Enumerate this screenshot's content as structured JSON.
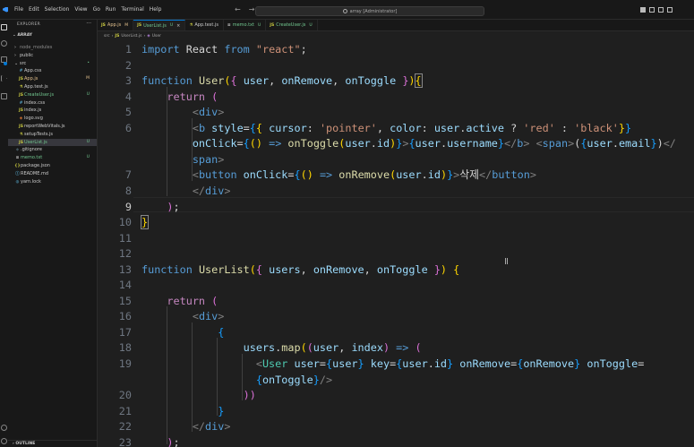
{
  "titlebar": {
    "menu": [
      "File",
      "Edit",
      "Selection",
      "View",
      "Go",
      "Run",
      "Terminal",
      "Help"
    ],
    "search_text": "array [Administrator]"
  },
  "explorer": {
    "title": "EXPLORER",
    "root": "ARRAY",
    "outline": "OUTLINE",
    "items": [
      {
        "label": "node_modules",
        "kind": "folder",
        "depth": 1,
        "color": "#8b8b8b"
      },
      {
        "label": "public",
        "kind": "folder",
        "depth": 1,
        "color": "#cccccc"
      },
      {
        "label": "src",
        "kind": "folder-open",
        "depth": 1,
        "color": "#cccccc",
        "status": "•",
        "status_color": "#73c991"
      },
      {
        "label": "App.css",
        "kind": "file",
        "icon": "#",
        "icon_color": "#519aba",
        "depth": 2,
        "color": "#cccccc"
      },
      {
        "label": "App.js",
        "kind": "file",
        "icon": "JS",
        "icon_color": "#cbcb41",
        "depth": 2,
        "color": "#e2c08d",
        "status": "M",
        "status_color": "#e2c08d"
      },
      {
        "label": "App.test.js",
        "kind": "file",
        "icon": "⚗",
        "icon_color": "#cbcb41",
        "depth": 2,
        "color": "#cccccc"
      },
      {
        "label": "CreateUser.js",
        "kind": "file",
        "icon": "JS",
        "icon_color": "#cbcb41",
        "depth": 2,
        "color": "#73c991",
        "status": "U",
        "status_color": "#73c991"
      },
      {
        "label": "index.css",
        "kind": "file",
        "icon": "#",
        "icon_color": "#519aba",
        "depth": 2,
        "color": "#cccccc"
      },
      {
        "label": "index.js",
        "kind": "file",
        "icon": "JS",
        "icon_color": "#cbcb41",
        "depth": 2,
        "color": "#cccccc"
      },
      {
        "label": "logo.svg",
        "kind": "file",
        "icon": "◈",
        "icon_color": "#e37933",
        "depth": 2,
        "color": "#cccccc"
      },
      {
        "label": "reportWebVitals.js",
        "kind": "file",
        "icon": "JS",
        "icon_color": "#cbcb41",
        "depth": 2,
        "color": "#cccccc"
      },
      {
        "label": "setupTests.js",
        "kind": "file",
        "icon": "⚗",
        "icon_color": "#cbcb41",
        "depth": 2,
        "color": "#cccccc"
      },
      {
        "label": "UserList.js",
        "kind": "file",
        "icon": "JS",
        "icon_color": "#cbcb41",
        "depth": 2,
        "color": "#73c991",
        "status": "U",
        "status_color": "#73c991",
        "selected": true
      },
      {
        "label": ".gitignore",
        "kind": "file",
        "icon": "◆",
        "icon_color": "#41535b",
        "depth": 1,
        "color": "#cccccc"
      },
      {
        "label": "memo.txt",
        "kind": "file",
        "icon": "≡",
        "icon_color": "#cccccc",
        "depth": 1,
        "color": "#73c991",
        "status": "U",
        "status_color": "#73c991"
      },
      {
        "label": "package.json",
        "kind": "file",
        "icon": "{}",
        "icon_color": "#cbcb41",
        "depth": 1,
        "color": "#cccccc"
      },
      {
        "label": "README.md",
        "kind": "file",
        "icon": "ⓘ",
        "icon_color": "#519aba",
        "depth": 1,
        "color": "#cccccc"
      },
      {
        "label": "yarn.lock",
        "kind": "file",
        "icon": "◍",
        "icon_color": "#519aba",
        "depth": 1,
        "color": "#cccccc"
      }
    ]
  },
  "tabs": [
    {
      "label": "App.js",
      "icon": "JS",
      "icon_color": "#cbcb41",
      "status": "M",
      "label_color": "#e2c08d",
      "active": false
    },
    {
      "label": "UserList.js",
      "icon": "JS",
      "icon_color": "#cbcb41",
      "status": "U",
      "label_color": "#73c991",
      "active": true
    },
    {
      "label": "App.test.js",
      "icon": "⚗",
      "icon_color": "#cbcb41",
      "status": "",
      "label_color": "#cccccc",
      "active": false
    },
    {
      "label": "memo.txt",
      "icon": "≡",
      "icon_color": "#cccccc",
      "status": "U",
      "label_color": "#73c991",
      "active": false
    },
    {
      "label": "CreateUser.js",
      "icon": "JS",
      "icon_color": "#cbcb41",
      "status": "U",
      "label_color": "#73c991",
      "active": false
    }
  ],
  "breadcrumb": [
    "src",
    "UserList.js",
    "User"
  ],
  "editor": {
    "active_line": "9",
    "lines": [
      {
        "num": "1",
        "tokens": [
          [
            "kw",
            "import"
          ],
          [
            "tx",
            " React "
          ],
          [
            "kw",
            "from"
          ],
          [
            "tx",
            " "
          ],
          [
            "str",
            "\"react\""
          ],
          [
            "tx",
            ";"
          ]
        ]
      },
      {
        "num": "2",
        "tokens": []
      },
      {
        "num": "3",
        "tokens": [
          [
            "kw",
            "function"
          ],
          [
            "tx",
            " "
          ],
          [
            "fn",
            "User"
          ],
          [
            "b1",
            "("
          ],
          [
            "b2",
            "{"
          ],
          [
            "tx",
            " "
          ],
          [
            "vr",
            "user"
          ],
          [
            "tx",
            ", "
          ],
          [
            "vr",
            "onRemove"
          ],
          [
            "tx",
            ", "
          ],
          [
            "vr",
            "onToggle"
          ],
          [
            "tx",
            " "
          ],
          [
            "b2",
            "}"
          ],
          [
            "b1",
            ")"
          ],
          [
            "b1",
            "{"
          ]
        ]
      },
      {
        "num": "4",
        "tokens": [
          [
            "tx",
            "    "
          ],
          [
            "ctl",
            "return"
          ],
          [
            "tx",
            " "
          ],
          [
            "b2",
            "("
          ]
        ]
      },
      {
        "num": "5",
        "tokens": [
          [
            "tx",
            "        "
          ],
          [
            "gy",
            "<"
          ],
          [
            "tg",
            "div"
          ],
          [
            "gy",
            ">"
          ]
        ]
      },
      {
        "num": "6",
        "tokens": [
          [
            "tx",
            "        "
          ],
          [
            "gy",
            "<"
          ],
          [
            "tg",
            "b"
          ],
          [
            "tx",
            " "
          ],
          [
            "vr",
            "style"
          ],
          [
            "tx",
            "="
          ],
          [
            "b3",
            "{"
          ],
          [
            "b1",
            "{"
          ],
          [
            "tx",
            " "
          ],
          [
            "vr",
            "cursor"
          ],
          [
            "tx",
            ": "
          ],
          [
            "str",
            "'pointer'"
          ],
          [
            "tx",
            ", "
          ],
          [
            "vr",
            "color"
          ],
          [
            "tx",
            ": "
          ],
          [
            "vr",
            "user"
          ],
          [
            "tx",
            "."
          ],
          [
            "vr",
            "active"
          ],
          [
            "tx",
            " ? "
          ],
          [
            "str",
            "'red'"
          ],
          [
            "tx",
            " : "
          ],
          [
            "str",
            "'black'"
          ],
          [
            "b1",
            "}"
          ],
          [
            "b3",
            "}"
          ]
        ]
      },
      {
        "num": "",
        "tokens": [
          [
            "tx",
            "        "
          ],
          [
            "vr",
            "onClick"
          ],
          [
            "tx",
            "="
          ],
          [
            "b3",
            "{"
          ],
          [
            "b1",
            "("
          ],
          [
            "b1",
            ")"
          ],
          [
            "tx",
            " "
          ],
          [
            "kw",
            "=>"
          ],
          [
            "tx",
            " "
          ],
          [
            "fn",
            "onToggle"
          ],
          [
            "b1",
            "("
          ],
          [
            "vr",
            "user"
          ],
          [
            "tx",
            "."
          ],
          [
            "vr",
            "id"
          ],
          [
            "b1",
            ")"
          ],
          [
            "b3",
            "}"
          ],
          [
            "gy",
            ">"
          ],
          [
            "b3",
            "{"
          ],
          [
            "vr",
            "user"
          ],
          [
            "tx",
            "."
          ],
          [
            "vr",
            "username"
          ],
          [
            "b3",
            "}"
          ],
          [
            "gy",
            "</"
          ],
          [
            "tg",
            "b"
          ],
          [
            "gy",
            ">"
          ],
          [
            "tx",
            " "
          ],
          [
            "gy",
            "<"
          ],
          [
            "tg",
            "span"
          ],
          [
            "gy",
            ">"
          ],
          [
            "tx",
            "("
          ],
          [
            "b3",
            "{"
          ],
          [
            "vr",
            "user"
          ],
          [
            "tx",
            "."
          ],
          [
            "vr",
            "email"
          ],
          [
            "b3",
            "}"
          ],
          [
            "tx",
            ")"
          ],
          [
            "gy",
            "</"
          ]
        ]
      },
      {
        "num": "",
        "tokens": [
          [
            "tx",
            "        "
          ],
          [
            "tg",
            "span"
          ],
          [
            "gy",
            ">"
          ]
        ]
      },
      {
        "num": "7",
        "tokens": [
          [
            "tx",
            "        "
          ],
          [
            "gy",
            "<"
          ],
          [
            "tg",
            "button"
          ],
          [
            "tx",
            " "
          ],
          [
            "vr",
            "onClick"
          ],
          [
            "tx",
            "="
          ],
          [
            "b3",
            "{"
          ],
          [
            "b1",
            "("
          ],
          [
            "b1",
            ")"
          ],
          [
            "tx",
            " "
          ],
          [
            "kw",
            "=>"
          ],
          [
            "tx",
            " "
          ],
          [
            "fn",
            "onRemove"
          ],
          [
            "b1",
            "("
          ],
          [
            "vr",
            "user"
          ],
          [
            "tx",
            "."
          ],
          [
            "vr",
            "id"
          ],
          [
            "b1",
            ")"
          ],
          [
            "b3",
            "}"
          ],
          [
            "gy",
            ">"
          ],
          [
            "tx",
            "삭제"
          ],
          [
            "gy",
            "</"
          ],
          [
            "tg",
            "button"
          ],
          [
            "gy",
            ">"
          ]
        ]
      },
      {
        "num": "8",
        "tokens": [
          [
            "tx",
            "        "
          ],
          [
            "gy",
            "</"
          ],
          [
            "tg",
            "div"
          ],
          [
            "gy",
            ">"
          ]
        ]
      },
      {
        "num": "9",
        "tokens": [
          [
            "tx",
            "    "
          ],
          [
            "b2",
            ")"
          ],
          [
            "tx",
            ";"
          ]
        ]
      },
      {
        "num": "10",
        "tokens": [
          [
            "b1",
            "}"
          ]
        ]
      },
      {
        "num": "11",
        "tokens": []
      },
      {
        "num": "12",
        "tokens": []
      },
      {
        "num": "13",
        "tokens": [
          [
            "kw",
            "function"
          ],
          [
            "tx",
            " "
          ],
          [
            "fn",
            "UserList"
          ],
          [
            "b1",
            "("
          ],
          [
            "b2",
            "{"
          ],
          [
            "tx",
            " "
          ],
          [
            "vr",
            "users"
          ],
          [
            "tx",
            ", "
          ],
          [
            "vr",
            "onRemove"
          ],
          [
            "tx",
            ", "
          ],
          [
            "vr",
            "onToggle"
          ],
          [
            "tx",
            " "
          ],
          [
            "b2",
            "}"
          ],
          [
            "b1",
            ")"
          ],
          [
            "tx",
            " "
          ],
          [
            "b1",
            "{"
          ]
        ]
      },
      {
        "num": "14",
        "tokens": []
      },
      {
        "num": "15",
        "tokens": [
          [
            "tx",
            "    "
          ],
          [
            "ctl",
            "return"
          ],
          [
            "tx",
            " "
          ],
          [
            "b2",
            "("
          ]
        ]
      },
      {
        "num": "16",
        "tokens": [
          [
            "tx",
            "        "
          ],
          [
            "gy",
            "<"
          ],
          [
            "tg",
            "div"
          ],
          [
            "gy",
            ">"
          ]
        ]
      },
      {
        "num": "17",
        "tokens": [
          [
            "tx",
            "            "
          ],
          [
            "b3",
            "{"
          ]
        ]
      },
      {
        "num": "18",
        "tokens": [
          [
            "tx",
            "                "
          ],
          [
            "vr",
            "users"
          ],
          [
            "tx",
            "."
          ],
          [
            "fn",
            "map"
          ],
          [
            "b1",
            "("
          ],
          [
            "b2",
            "("
          ],
          [
            "vr",
            "user"
          ],
          [
            "tx",
            ", "
          ],
          [
            "vr",
            "index"
          ],
          [
            "b2",
            ")"
          ],
          [
            "tx",
            " "
          ],
          [
            "kw",
            "=>"
          ],
          [
            "tx",
            " "
          ],
          [
            "b2",
            "("
          ]
        ]
      },
      {
        "num": "19",
        "tokens": [
          [
            "tx",
            "                  "
          ],
          [
            "gy",
            "<"
          ],
          [
            "cm",
            "User"
          ],
          [
            "tx",
            " "
          ],
          [
            "vr",
            "user"
          ],
          [
            "tx",
            "="
          ],
          [
            "b3",
            "{"
          ],
          [
            "vr",
            "user"
          ],
          [
            "b3",
            "}"
          ],
          [
            "tx",
            " "
          ],
          [
            "vr",
            "key"
          ],
          [
            "tx",
            "="
          ],
          [
            "b3",
            "{"
          ],
          [
            "vr",
            "user"
          ],
          [
            "tx",
            "."
          ],
          [
            "vr",
            "id"
          ],
          [
            "b3",
            "}"
          ],
          [
            "tx",
            " "
          ],
          [
            "vr",
            "onRemove"
          ],
          [
            "tx",
            "="
          ],
          [
            "b3",
            "{"
          ],
          [
            "vr",
            "onRemove"
          ],
          [
            "b3",
            "}"
          ],
          [
            "tx",
            " "
          ],
          [
            "vr",
            "onToggle"
          ],
          [
            "tx",
            "="
          ]
        ]
      },
      {
        "num": "",
        "tokens": [
          [
            "tx",
            "                  "
          ],
          [
            "b3",
            "{"
          ],
          [
            "vr",
            "onToggle"
          ],
          [
            "b3",
            "}"
          ],
          [
            "gy",
            "/>"
          ]
        ]
      },
      {
        "num": "20",
        "tokens": [
          [
            "tx",
            "                "
          ],
          [
            "b2",
            "))"
          ]
        ]
      },
      {
        "num": "21",
        "tokens": [
          [
            "tx",
            "            "
          ],
          [
            "b3",
            "}"
          ]
        ]
      },
      {
        "num": "22",
        "tokens": [
          [
            "tx",
            "        "
          ],
          [
            "gy",
            "</"
          ],
          [
            "tg",
            "div"
          ],
          [
            "gy",
            ">"
          ]
        ]
      },
      {
        "num": "23",
        "tokens": [
          [
            "tx",
            "    "
          ],
          [
            "b2",
            ")"
          ],
          [
            "tx",
            ";"
          ]
        ]
      }
    ]
  }
}
